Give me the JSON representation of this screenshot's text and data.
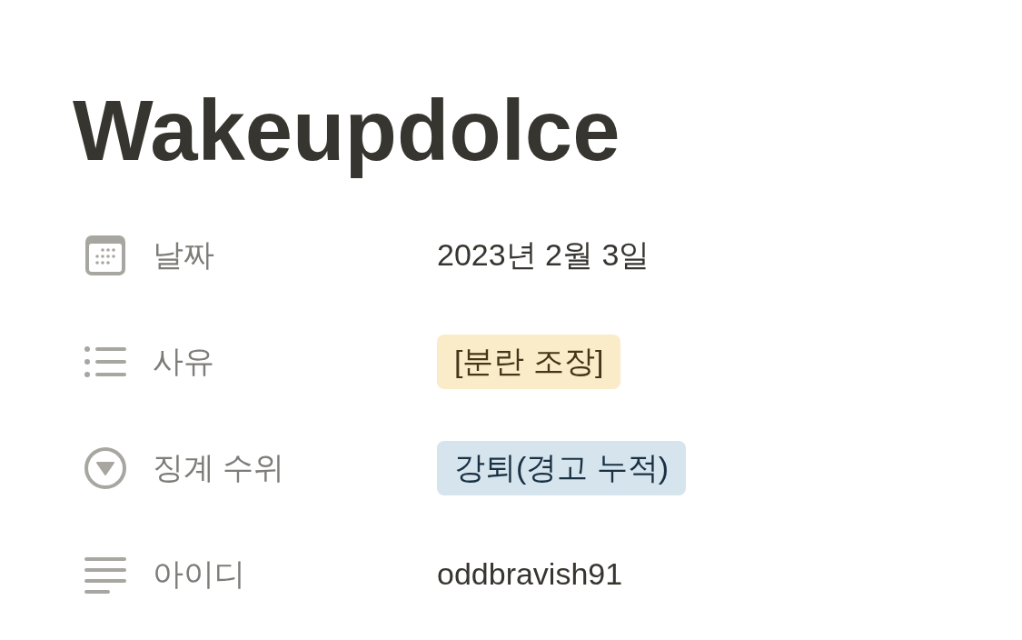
{
  "page": {
    "title": "Wakeupdolce"
  },
  "properties": [
    {
      "kind": "date",
      "label": "날짜",
      "value": "2023년 2월 3일"
    },
    {
      "kind": "multi_select",
      "label": "사유",
      "tags": [
        {
          "text": "[분란 조장]",
          "color": "#fbecc9"
        }
      ]
    },
    {
      "kind": "select",
      "label": "징계 수위",
      "tags": [
        {
          "text": "강퇴(경고 누적)",
          "color": "#d6e4ee"
        }
      ]
    },
    {
      "kind": "text",
      "label": "아이디",
      "value": "oddbravish91"
    }
  ]
}
